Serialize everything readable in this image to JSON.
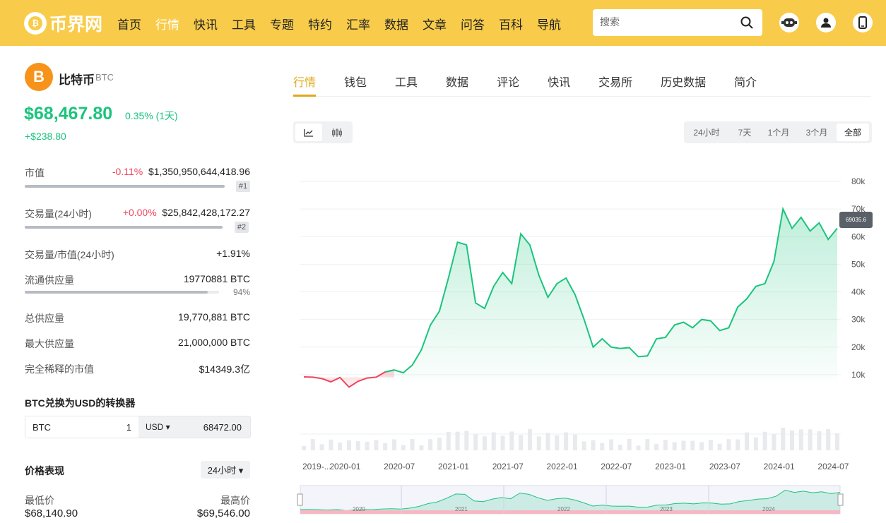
{
  "header": {
    "logo_text": "币界网",
    "nav": [
      "首页",
      "行情",
      "快讯",
      "工具",
      "专题",
      "特约",
      "汇率",
      "数据",
      "文章",
      "问答",
      "百科",
      "导航"
    ],
    "active_nav": 1,
    "search_placeholder": "搜索"
  },
  "coin": {
    "name": "比特币",
    "symbol": "BTC",
    "logo_glyph": "B",
    "price": "$68,467.80",
    "change_pct": "0.35% (1天)",
    "change_abs": "+$238.80"
  },
  "stats": {
    "market_cap": {
      "label": "市值",
      "change": "-0.11%",
      "value": "$1,350,950,644,418.96",
      "rank": "#1"
    },
    "volume": {
      "label": "交易量(24小时)",
      "change": "+0.00%",
      "value": "$25,842,428,172.27",
      "rank": "#2"
    },
    "vol_mcap": {
      "label": "交易量/市值(24小时)",
      "value": "+1.91%"
    },
    "circulating": {
      "label": "流通供应量",
      "value": "19770881 BTC",
      "pct_text": "94%",
      "pct": 0.94
    },
    "total": {
      "label": "总供应量",
      "value": "19,770,881 BTC"
    },
    "max": {
      "label": "最大供应量",
      "value": "21,000,000 BTC"
    },
    "fdv": {
      "label": "完全稀释的市值",
      "value": "$14349.3亿"
    }
  },
  "converter": {
    "title": "BTC兑换为USD的转换器",
    "from": "BTC",
    "amount": "1",
    "to": "USD ▾",
    "result": "68472.00"
  },
  "performance": {
    "title": "价格表现",
    "period": "24小时 ▾",
    "low_label": "最低价",
    "high_label": "最高价",
    "low": "$68,140.90",
    "high": "$69,546.00"
  },
  "tabs": [
    "行情",
    "钱包",
    "工具",
    "数据",
    "评论",
    "快讯",
    "交易所",
    "历史数据",
    "简介"
  ],
  "ranges": [
    "24小时",
    "7天",
    "1个月",
    "3个月",
    "全部"
  ],
  "active_range": 4,
  "chart_data": {
    "type": "area",
    "y_ticks": [
      "10k",
      "20k",
      "30k",
      "40k",
      "50k",
      "60k",
      "70k",
      "80k"
    ],
    "x_ticks": [
      "2019-...",
      "2020-01",
      "2020-07",
      "2021-01",
      "2021-07",
      "2022-01",
      "2022-07",
      "2023-01",
      "2023-07",
      "2024-01",
      "2024-07"
    ],
    "navigator_ticks": [
      "2020",
      "2021",
      "2022",
      "2023",
      "2024"
    ],
    "current_label": "69035.6",
    "ylim": [
      0,
      80000
    ],
    "colors": {
      "up": "#1bc47d",
      "down": "#f0445c"
    },
    "x": [
      "2019-10",
      "2019-11",
      "2019-12",
      "2020-01",
      "2020-02",
      "2020-03",
      "2020-04",
      "2020-05",
      "2020-06",
      "2020-07",
      "2020-08",
      "2020-09",
      "2020-10",
      "2020-11",
      "2020-12",
      "2021-01",
      "2021-02",
      "2021-03",
      "2021-04",
      "2021-05",
      "2021-06",
      "2021-07",
      "2021-08",
      "2021-09",
      "2021-10",
      "2021-11",
      "2021-12",
      "2022-01",
      "2022-02",
      "2022-03",
      "2022-04",
      "2022-05",
      "2022-06",
      "2022-07",
      "2022-08",
      "2022-09",
      "2022-10",
      "2022-11",
      "2022-12",
      "2023-01",
      "2023-02",
      "2023-03",
      "2023-04",
      "2023-05",
      "2023-06",
      "2023-07",
      "2023-08",
      "2023-09",
      "2023-10",
      "2023-11",
      "2023-12",
      "2024-01",
      "2024-02",
      "2024-03",
      "2024-04",
      "2024-05",
      "2024-06",
      "2024-07",
      "2024-08",
      "2024-09"
    ],
    "values": [
      9200,
      9100,
      8600,
      7400,
      9000,
      5500,
      7600,
      8800,
      9100,
      11000,
      11700,
      10700,
      13500,
      19000,
      28000,
      33000,
      45000,
      58000,
      57000,
      36000,
      34000,
      42000,
      47000,
      43000,
      61000,
      57000,
      46000,
      38000,
      43000,
      45000,
      39000,
      30000,
      20000,
      23000,
      20000,
      19500,
      19800,
      16500,
      16800,
      23000,
      23500,
      28000,
      29000,
      27000,
      30000,
      29500,
      26000,
      27000,
      34500,
      37500,
      42000,
      43000,
      51000,
      70000,
      63000,
      67000,
      62000,
      65000,
      59000,
      63000
    ]
  }
}
